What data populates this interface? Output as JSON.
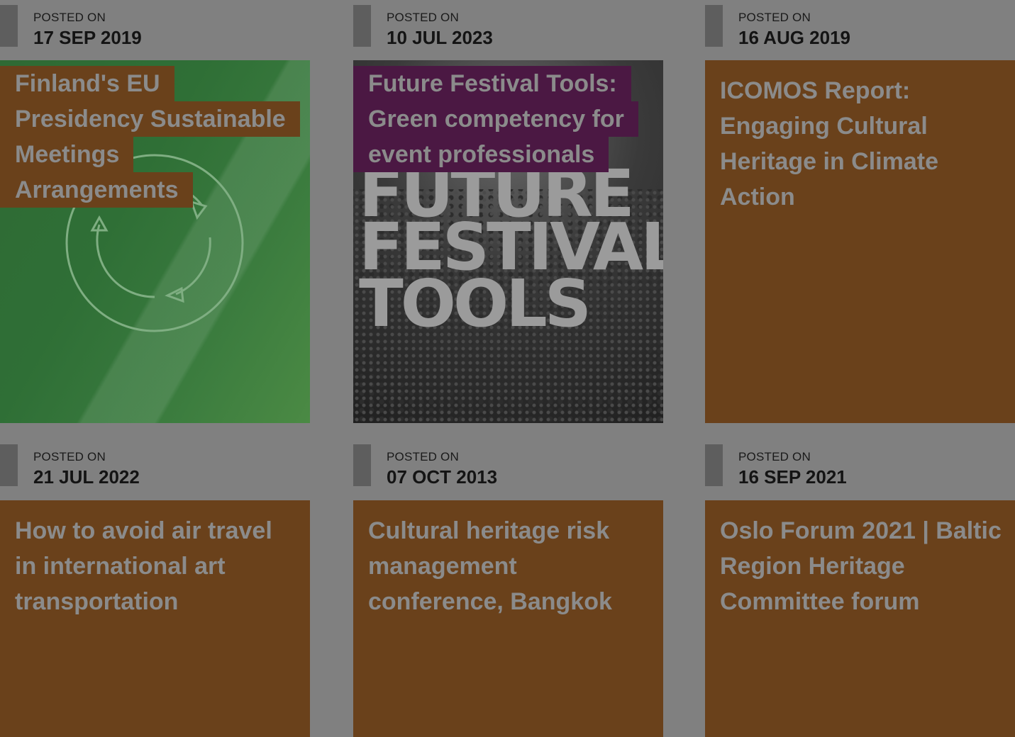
{
  "posts": [
    {
      "caption": "POSTED ON",
      "date": "17 SEP 2019",
      "title_lines": [
        "Finland's EU",
        "Presidency Sustainable",
        "Meetings",
        "Arrangements"
      ],
      "image": "green-recycle-graphic"
    },
    {
      "caption": "POSTED ON",
      "date": "10 JUL 2023",
      "title_lines": [
        "Future Festival Tools:",
        "Green competency for",
        "event professionals"
      ],
      "image": "future-festival-tools-crowd",
      "image_words": [
        "FUTURE",
        "FESTIVAL",
        "TOOLS"
      ]
    },
    {
      "caption": "POSTED ON",
      "date": "16 AUG 2019",
      "title": "ICOMOS Report: Engaging Cultural Heritage in Climate Action"
    },
    {
      "caption": "POSTED ON",
      "date": "21 JUL 2022",
      "title": "How to avoid air travel in international art transportation"
    },
    {
      "caption": "POSTED ON",
      "date": "07 OCT 2013",
      "title": "Cultural heritage risk management conference, Bangkok"
    },
    {
      "caption": "POSTED ON",
      "date": "16 SEP 2021",
      "title": "Oslo Forum 2021 | Baltic Region Heritage Committee forum"
    }
  ],
  "colors": {
    "overlay": "#808080",
    "card_brown": "#6a411b",
    "card_purple": "#4b1843",
    "title_text": "#8b8b8b"
  }
}
